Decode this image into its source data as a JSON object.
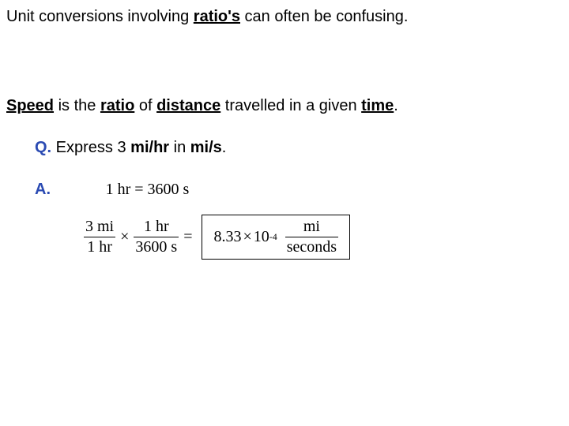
{
  "line1": {
    "pre": "Unit conversions involving ",
    "kw": "ratio's",
    "post": " can often be confusing."
  },
  "line2": {
    "s1": "Speed",
    "t1": " is the ",
    "s2": "ratio",
    "t2": " of ",
    "s3": "distance",
    "t3": " travelled in a given ",
    "s4": "time",
    "t4": "."
  },
  "question": {
    "label": "Q.",
    "pre": " Express 3 ",
    "u1": "mi/hr",
    "mid": " in ",
    "u2": "mi/s",
    "post": "."
  },
  "answer": {
    "label": "A.",
    "hr_eq": "1 hr = 3600 s"
  },
  "calc": {
    "f1_num": "3 mi",
    "f1_den": "1 hr",
    "times": "×",
    "f2_num": "1 hr",
    "f2_den": "3600 s",
    "eq": "=",
    "result_coeff": "8.33",
    "result_times": "×",
    "result_base": "10",
    "result_exp": "-4",
    "result_unit_num": "mi",
    "result_unit_den": "seconds"
  }
}
